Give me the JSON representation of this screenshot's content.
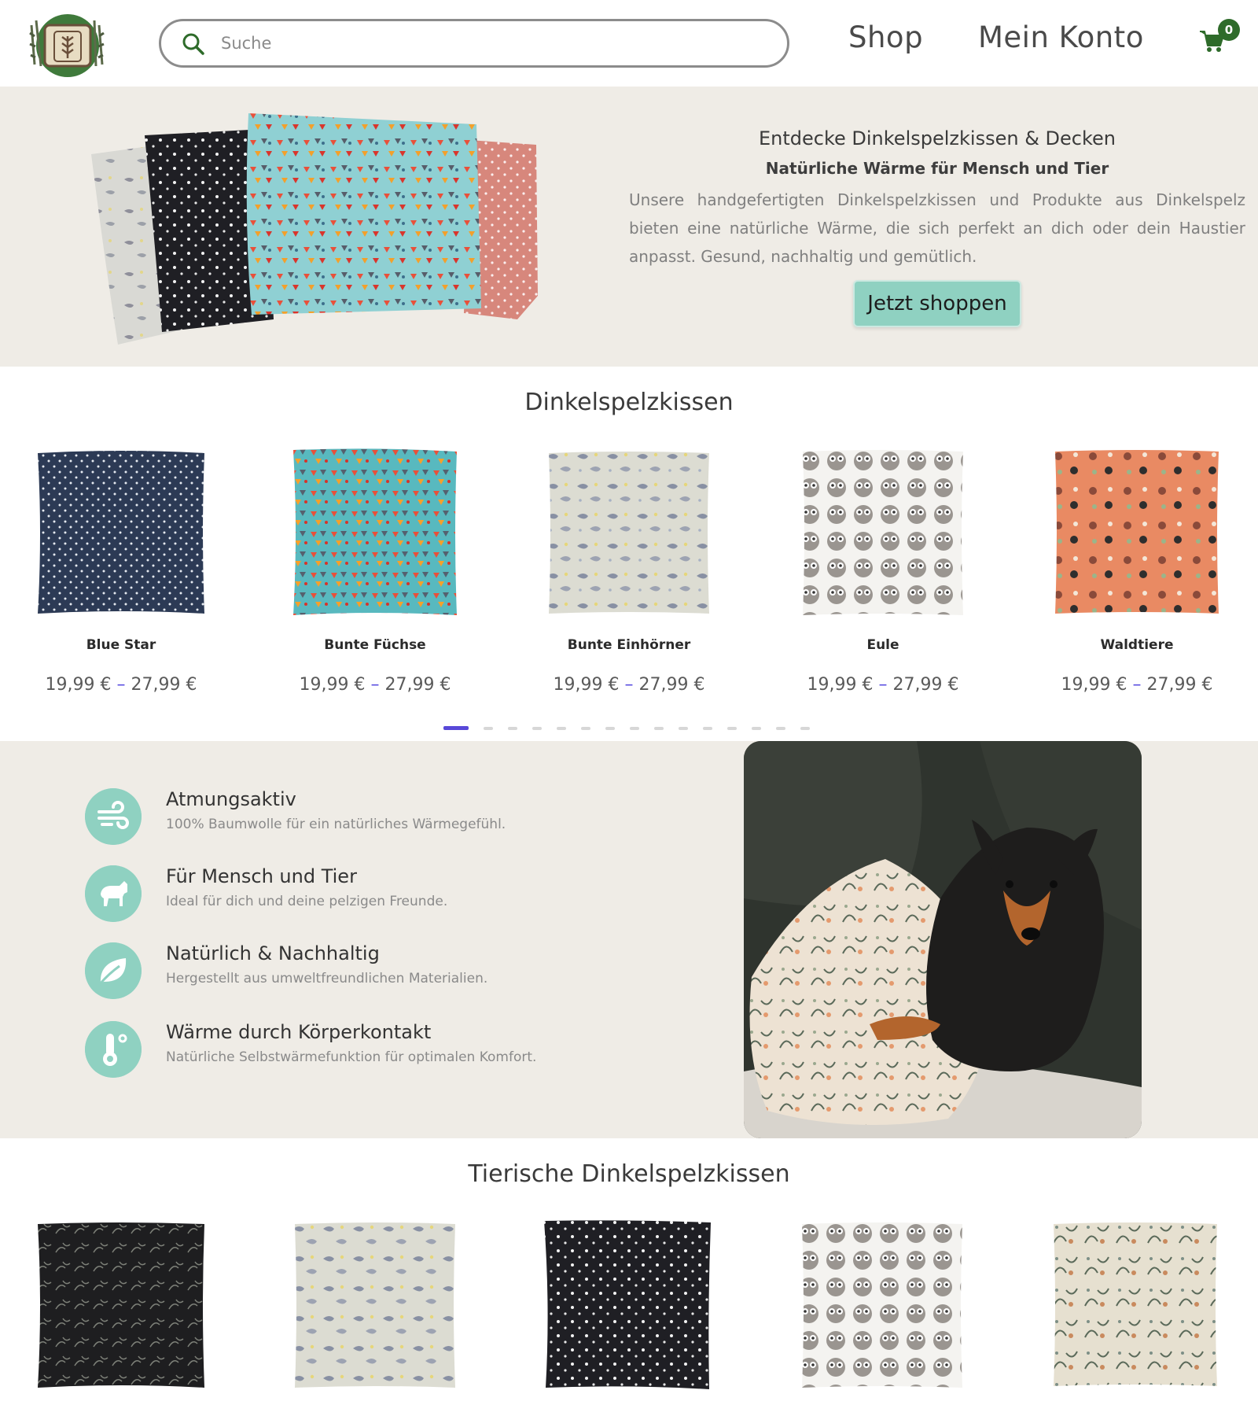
{
  "header": {
    "search_placeholder": "Suche",
    "nav": {
      "shop": "Shop",
      "account": "Mein Konto"
    },
    "cart_count": "0"
  },
  "hero": {
    "title": "Entdecke Dinkelspelzkissen & Decken",
    "subtitle": "Natürliche Wärme für Mensch und Tier",
    "text": "Unsere handgefertigten Dinkelspelzkissen und Produkte aus Dinkelspelz bieten eine natürliche Wärme, die sich perfekt an dich oder dein Haustier anpasst. Gesund, nachhaltig und gemütlich.",
    "button": "Jetzt shoppen"
  },
  "section1": {
    "title": "Dinkelspelzkissen",
    "products": [
      {
        "name": "Blue Star",
        "price_min": "19,99 €",
        "price_max": "27,99 €"
      },
      {
        "name": "Bunte Füchse",
        "price_min": "19,99 €",
        "price_max": "27,99 €"
      },
      {
        "name": "Bunte Einhörner",
        "price_min": "19,99 €",
        "price_max": "27,99 €"
      },
      {
        "name": "Eule",
        "price_min": "19,99 €",
        "price_max": "27,99 €"
      },
      {
        "name": "Waldtiere",
        "price_min": "19,99 €",
        "price_max": "27,99 €"
      }
    ],
    "slider_pages": 15,
    "slider_active": 1
  },
  "features": [
    {
      "title": "Atmungsaktiv",
      "desc": "100% Baumwolle für ein natürliches Wärmegefühl.",
      "icon": "wind-icon"
    },
    {
      "title": "Für Mensch und Tier",
      "desc": "Ideal für dich und deine pelzigen Freunde.",
      "icon": "horse-icon"
    },
    {
      "title": "Natürlich & Nachhaltig",
      "desc": "Hergestellt aus umweltfreundlichen Materialien.",
      "icon": "leaf-icon"
    },
    {
      "title": "Wärme durch Körperkontakt",
      "desc": "Natürliche Selbstwärmefunktion für optimalen Komfort.",
      "icon": "thermometer-icon"
    }
  ],
  "section2": {
    "title": "Tierische Dinkelspelzkissen"
  },
  "colors": {
    "accent": "#8fd1c1",
    "brand_green": "#2e6b2a",
    "hero_bg": "#efece6",
    "slider_active": "#5848d8"
  }
}
